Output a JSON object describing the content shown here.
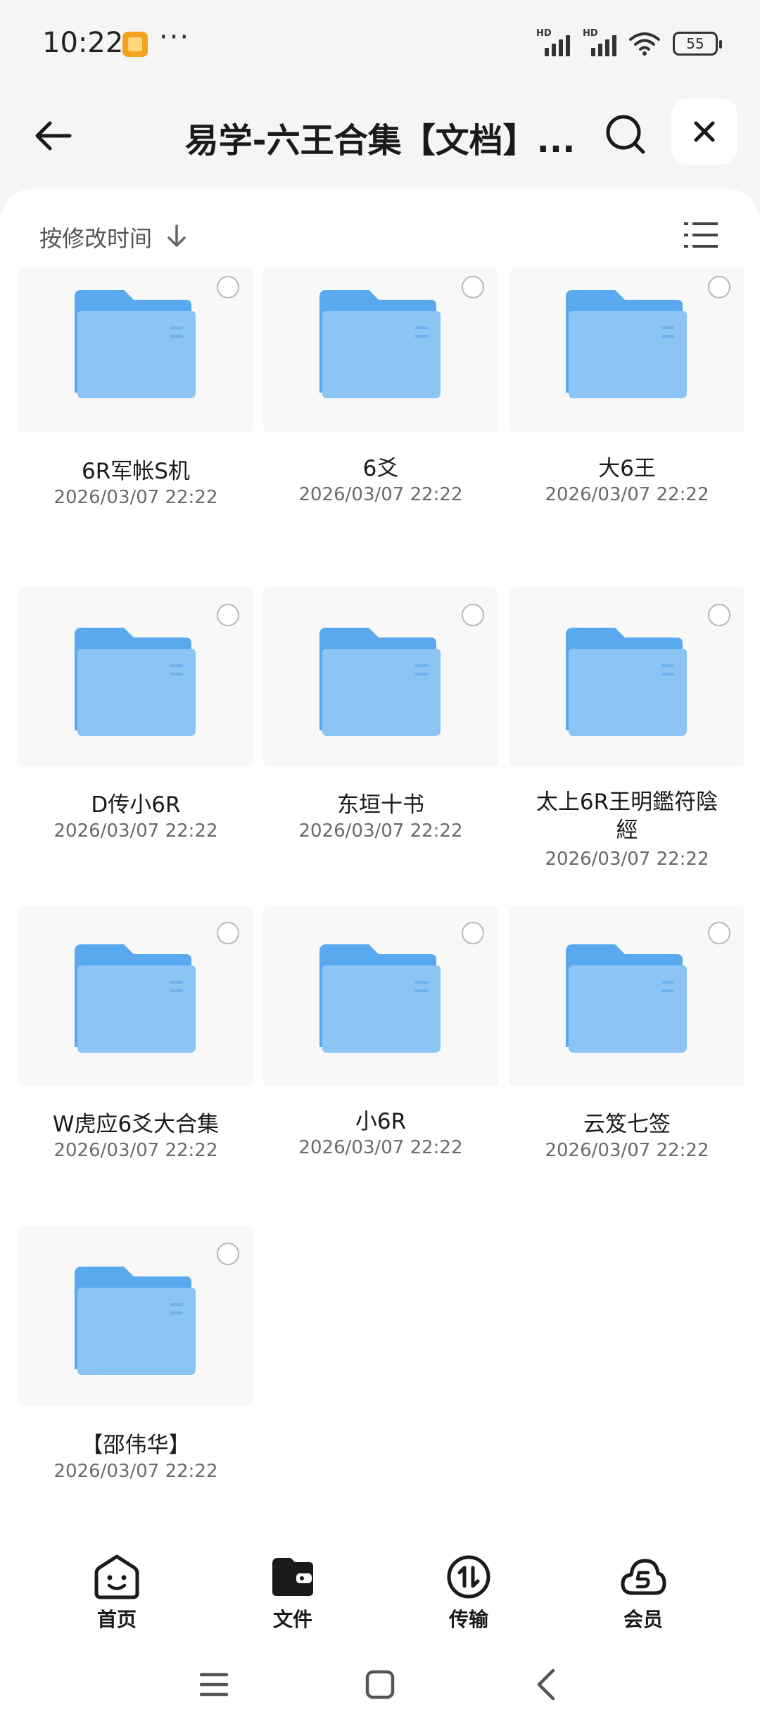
{
  "status": {
    "time": "10:22",
    "dots": "···",
    "hd_label": "HD",
    "battery": "55"
  },
  "header": {
    "title": "易学-六王合集【文档】...",
    "icons": [
      "back-arrow-icon",
      "search-icon",
      "close-icon"
    ]
  },
  "sort": {
    "label": "按修改时间",
    "direction_icon": "arrow-down-icon",
    "view_icon": "list-view-icon"
  },
  "colors": {
    "folder_back": "#5aa9ef",
    "folder_front": "#8cc4f5",
    "accent": "#1a1a1a"
  },
  "files": [
    {
      "name": "6R军帐S机",
      "date": "2026/03/07 22:22"
    },
    {
      "name": "6爻",
      "date": "2026/03/07 22:22"
    },
    {
      "name": "大6王",
      "date": "2026/03/07 22:22"
    },
    {
      "name": "D传小6R",
      "date": "2026/03/07 22:22"
    },
    {
      "name": "东垣十书",
      "date": "2026/03/07 22:22"
    },
    {
      "name_line1": "太上6R王明鑑符陰",
      "name_line2": "經",
      "date": "2026/03/07 22:22"
    },
    {
      "name": "W虎应6爻大合集",
      "date": "2026/03/07 22:22"
    },
    {
      "name": "小6R",
      "date": "2026/03/07 22:22"
    },
    {
      "name": "云笈七签",
      "date": "2026/03/07 22:22"
    },
    {
      "name": "【邵伟华】",
      "date": "2026/03/07 22:22"
    }
  ],
  "bottom_nav": [
    {
      "label": "首页",
      "icon": "smile-home-icon"
    },
    {
      "label": "文件",
      "icon": "folder-wallet-icon",
      "active": true
    },
    {
      "label": "传输",
      "icon": "transfer-icon"
    },
    {
      "label": "会员",
      "icon": "cloud-member-icon"
    }
  ]
}
